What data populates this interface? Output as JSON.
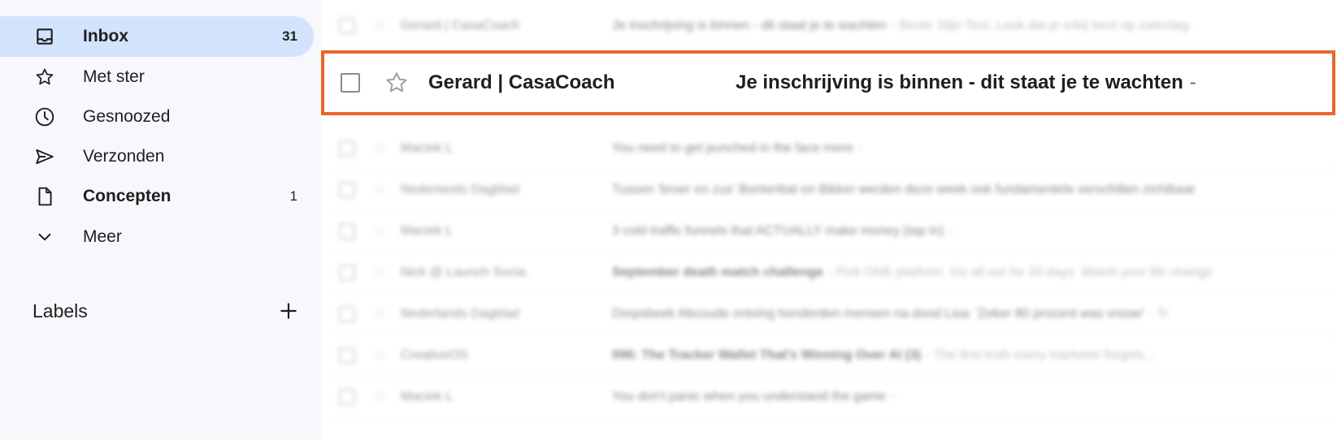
{
  "sidebar": {
    "items": [
      {
        "label": "Inbox",
        "count": "31",
        "icon": "inbox-icon"
      },
      {
        "label": "Met ster",
        "count": "",
        "icon": "star-icon"
      },
      {
        "label": "Gesnoozed",
        "count": "",
        "icon": "clock-icon"
      },
      {
        "label": "Verzonden",
        "count": "",
        "icon": "send-icon"
      },
      {
        "label": "Concepten",
        "count": "1",
        "icon": "draft-icon"
      },
      {
        "label": "Meer",
        "count": "",
        "icon": "chevron-down-icon"
      }
    ],
    "labels_title": "Labels"
  },
  "focused_email": {
    "sender": "Gerard | CasaCoach",
    "subject": "Je inschrijving is binnen - dit staat je te wachten",
    "separator": "-"
  },
  "emails": [
    {
      "sender": "Gerard | CasaCoach",
      "subject": "Je inschrijving is binnen - dit staat je te wachten",
      "snippet": "- Beste Stijn Test, Leuk dat je erbij bent op zaterdag"
    },
    {
      "sender": "Maciek L",
      "subject": "You need to get punched in the face more",
      "snippet": "-"
    },
    {
      "sender": "Nederlands Dagblad",
      "subject": "Tussen 'broer en zus' Bontenbal en Bikker werden deze week ook fundamentele verschillen zichtbaar",
      "snippet": ""
    },
    {
      "sender": "Maciek L",
      "subject": "3 cold traffic funnels that ACTUALLY make money (tap in)",
      "snippet": "-"
    },
    {
      "sender": "Nick @ Launch Socia.",
      "subject": "September death match challenge",
      "snippet": "- Pick ONE platform. Go all out for 30 days. Watch your life change"
    },
    {
      "sender": "Nederlands Dagblad",
      "subject": "Dorpsbeek Abcoude ontving honderden mensen na dood Lisa: 'Zeker 80 procent was vrouw'",
      "snippet": "- Tr"
    },
    {
      "sender": "CreativeOS",
      "subject": "096: The Tracker Wallet That's Winning Over AI (3)",
      "snippet": "- The first truth every marketer forgets..."
    },
    {
      "sender": "Maciek L",
      "subject": "You don't panic when you understand the game",
      "snippet": "-"
    }
  ],
  "colors": {
    "accent_outline": "#e8672a",
    "active_nav": "#d3e3fd",
    "sidebar_bg": "#f6f8fc"
  }
}
